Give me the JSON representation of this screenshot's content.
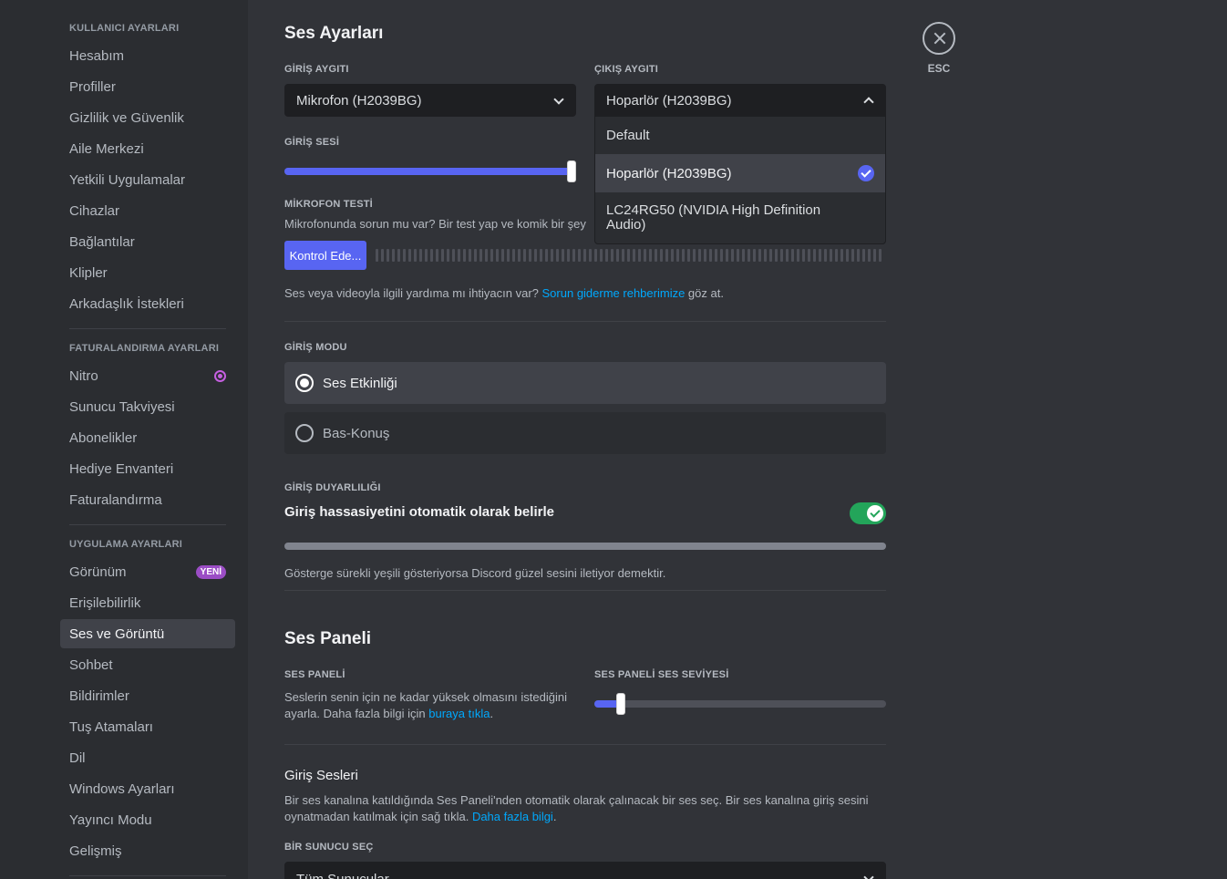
{
  "sidebar": {
    "user_header": "KULLANICI AYARLARI",
    "user_items": [
      "Hesabım",
      "Profiller",
      "Gizlilik ve Güvenlik",
      "Aile Merkezi",
      "Yetkili Uygulamalar",
      "Cihazlar",
      "Bağlantılar",
      "Klipler",
      "Arkadaşlık İstekleri"
    ],
    "billing_header": "FATURALANDIRMA AYARLARI",
    "billing_items": [
      "Nitro",
      "Sunucu Takviyesi",
      "Abonelikler",
      "Hediye Envanteri",
      "Faturalandırma"
    ],
    "app_header": "UYGULAMA AYARLARI",
    "app_items": [
      "Görünüm",
      "Erişilebilirlik",
      "Ses ve Görüntü",
      "Sohbet",
      "Bildirimler",
      "Tuş Atamaları",
      "Dil",
      "Windows Ayarları",
      "Yayıncı Modu",
      "Gelişmiş"
    ],
    "new_badge": "YENİ",
    "selected_item": "Ses ve Görüntü"
  },
  "main": {
    "title": "Ses Ayarları",
    "input_device_label": "GİRİŞ AYGITI",
    "input_device_value": "Mikrofon (H2039BG)",
    "output_device_label": "ÇIKIŞ AYGITI",
    "output_device_value": "Hoparlör (H2039BG)",
    "output_options": [
      "Default",
      "Hoparlör (H2039BG)",
      "LC24RG50 (NVIDIA High Definition Audio)"
    ],
    "output_selected": "Hoparlör (H2039BG)",
    "input_volume_label": "GİRİŞ SESİ",
    "input_volume_level": 1.0,
    "mic_test_label": "MİKROFON TESTİ",
    "mic_test_desc": "Mikrofonunda sorun mu var? Bir test yap ve komik bir şey",
    "mic_test_button": "Kontrol Ede...",
    "help_text_pre": "Ses veya videoyla ilgili yardıma mı ihtiyacın var? ",
    "help_link": "Sorun giderme rehberimize",
    "help_text_post": " göz at.",
    "input_mode_label": "GİRİŞ MODU",
    "input_modes": [
      "Ses Etkinliği",
      "Bas-Konuş"
    ],
    "input_mode_selected": "Ses Etkinliği",
    "sensitivity_label": "GİRİŞ DUYARLILIĞI",
    "sensitivity_title": "Giriş hassasiyetini otomatik olarak belirle",
    "sensitivity_auto": true,
    "sensitivity_desc": "Gösterge sürekli yeşili gösteriyorsa Discord güzel sesini iletiyor demektir.",
    "soundboard_title": "Ses Paneli",
    "soundboard_label": "SES PANELİ",
    "soundboard_desc_pre": "Seslerin senin için ne kadar yüksek olmasını istediğini ayarla. Daha fazla bilgi için ",
    "soundboard_link": "buraya tıkla",
    "soundboard_desc_post": ".",
    "soundboard_volume_label": "SES PANELİ SES SEVİYESİ",
    "soundboard_volume_level": 0.09,
    "entrance_title": "Giriş Sesleri",
    "entrance_desc_pre": "Bir ses kanalına katıldığında Ses Paneli'nden otomatik olarak çalınacak bir ses seç. Bir ses kanalına giriş sesini oynatmadan katılmak için sağ tıkla. ",
    "entrance_link": "Daha fazla bilgi",
    "entrance_desc_post": ".",
    "server_select_label": "BİR SUNUCU SEÇ",
    "server_select_value": "Tüm Sunucular"
  },
  "close": {
    "esc_label": "ESC"
  },
  "colors": {
    "accent": "#5865f2",
    "toggle_on": "#23a55a",
    "link": "#00a8fc",
    "nitro": "#c55fe0"
  }
}
